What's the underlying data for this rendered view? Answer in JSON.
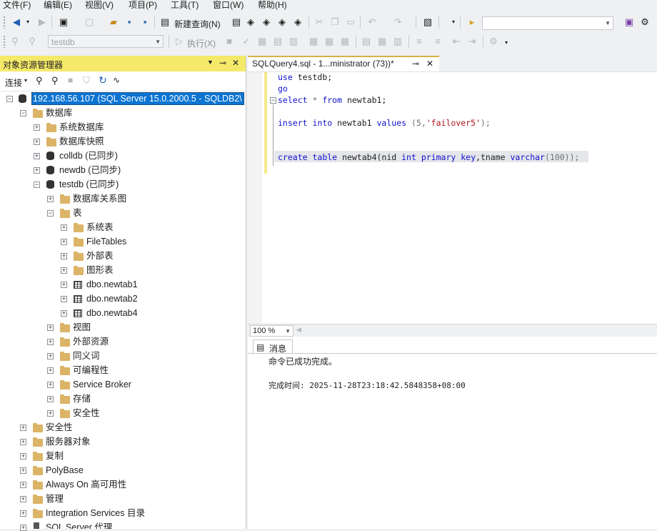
{
  "menu": [
    "文件(F)",
    "编辑(E)",
    "视图(V)",
    "项目(P)",
    "工具(T)",
    "窗口(W)",
    "帮助(H)"
  ],
  "toolbar": {
    "new_query": "新建查询(N)",
    "db_selector": "testdb",
    "execute": "执行(X)"
  },
  "object_explorer": {
    "title": "对象资源管理器",
    "connect": "连接",
    "server": "192.168.56.107 (SQL Server 15.0.2000.5 - SQLDB2\\",
    "nodes": {
      "databases": "数据库",
      "system_db": "系统数据库",
      "snapshots": "数据库快照",
      "colldb": "colldb (已同步)",
      "newdb": "newdb (已同步)",
      "testdb": "testdb (已同步)",
      "diagrams": "数据库关系图",
      "tables": "表",
      "system_tables": "系统表",
      "filetables": "FileTables",
      "external_tables": "外部表",
      "graph_tables": "图形表",
      "newtab1": "dbo.newtab1",
      "newtab2": "dbo.newtab2",
      "newtab4": "dbo.newtab4",
      "views": "视图",
      "external_resources": "外部资源",
      "synonyms": "同义词",
      "programmability": "可编程性",
      "service_broker": "Service Broker",
      "storage": "存储",
      "db_security": "安全性",
      "security": "安全性",
      "server_objects": "服务器对象",
      "replication": "复制",
      "polybase": "PolyBase",
      "always_on": "Always On 高可用性",
      "management": "管理",
      "integration": "Integration Services 目录",
      "agent": "SQL Server 代理"
    }
  },
  "editor": {
    "tab_title": "SQLQuery4.sql - 1...ministrator (73))*",
    "pin": "⊸",
    "close": "✕",
    "zoom": "100 %"
  },
  "code": {
    "l1_kw": "use",
    "l1_rest": " testdb;",
    "l2_kw": "go",
    "l3_kw1": "select",
    "l3_mid": " * ",
    "l3_kw2": "from",
    "l3_rest": " newtab1;",
    "l4_kw1": "insert",
    "l4_kw2": "into",
    "l4_tbl": " newtab1 ",
    "l4_kw3": "values",
    "l4_p1": " (5,",
    "l4_str": "'failover5'",
    "l4_p2": ");",
    "l5_kw1": "create",
    "l5_kw2": "table",
    "l5_name": " newtab4(nid ",
    "l5_kw3": "int",
    "l5_kw4": "primary",
    "l5_kw5": "key",
    "l5_mid": ",tname ",
    "l5_kw6": "varchar",
    "l5_end": "(100));"
  },
  "results": {
    "tab": "消息",
    "message": "命令已成功完成。",
    "completion_time": "完成时间: 2025-11-28T23:18:42.5848358+08:00"
  }
}
